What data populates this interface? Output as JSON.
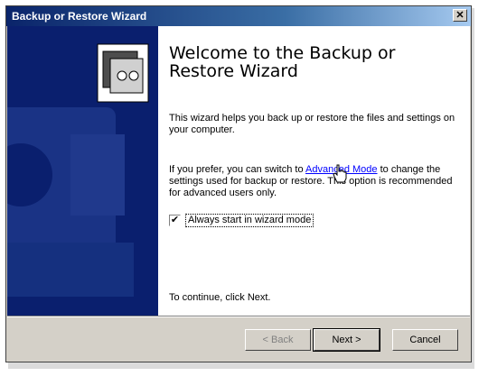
{
  "window": {
    "title": "Backup or Restore Wizard",
    "close_glyph": "✕"
  },
  "main": {
    "heading": "Welcome to the Backup or Restore Wizard",
    "intro": "This wizard helps you back up or restore the files and settings on your computer.",
    "advanced_prefix": "If you prefer, you can switch to ",
    "advanced_link": "Advanced Mode",
    "advanced_suffix": " to change the settings used for backup or restore. This option is recommended for advanced users only.",
    "checkbox_label": "Always start in wizard mode",
    "checkbox_checked": true,
    "checkbox_glyph": "✔",
    "continue_text": "To continue, click Next."
  },
  "buttons": {
    "back": "< Back",
    "next": "Next >",
    "cancel": "Cancel"
  },
  "colors": {
    "title_start": "#0a246a",
    "left_panel": "#0a1f6e",
    "link": "#0000ff",
    "face": "#d4d0c8"
  },
  "icons": [
    "backup-tape-icon",
    "close-icon",
    "hand-cursor-icon"
  ]
}
